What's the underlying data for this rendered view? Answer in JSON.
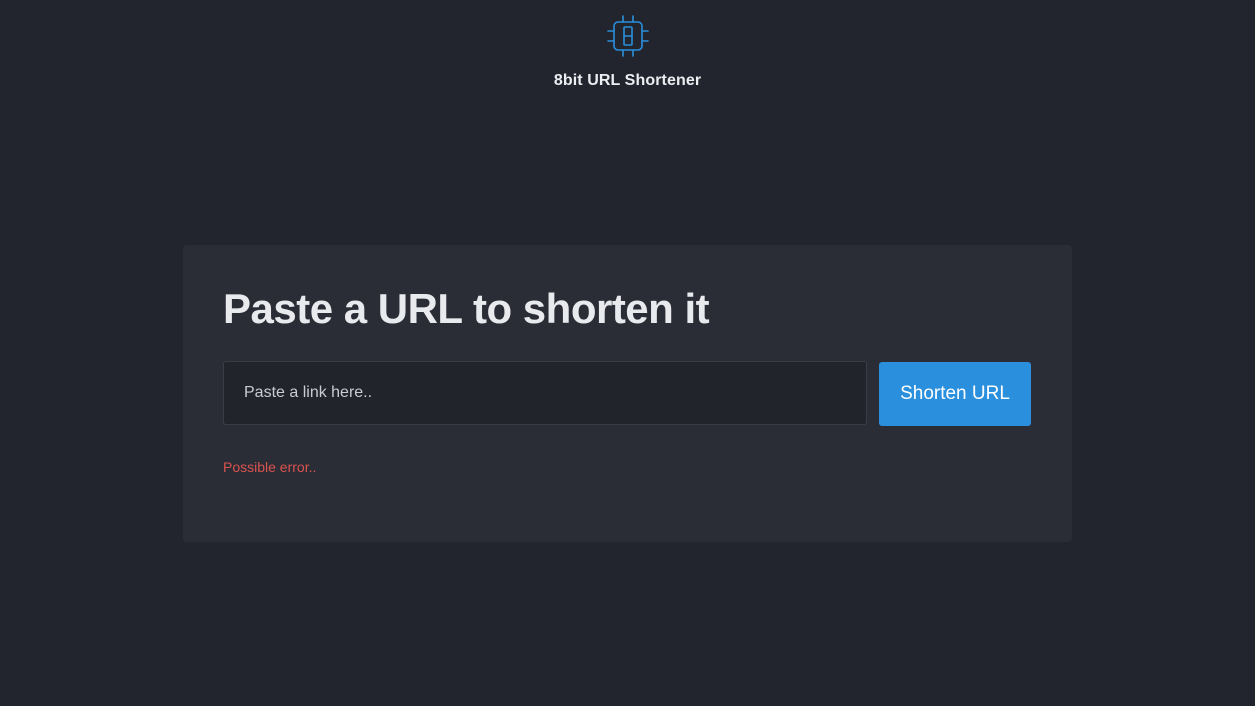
{
  "brand": {
    "logo_icon": "chip-8-icon",
    "name": "8bit URL Shortener"
  },
  "card": {
    "headline": "Paste a URL to shorten it",
    "input": {
      "placeholder": "Paste a link here..",
      "value": ""
    },
    "button_label": "Shorten URL",
    "error_message": "Possible error.."
  },
  "colors": {
    "background": "#23252e",
    "card": "#2b2d36",
    "accent": "#2a8fdc",
    "error": "#d9534f"
  }
}
